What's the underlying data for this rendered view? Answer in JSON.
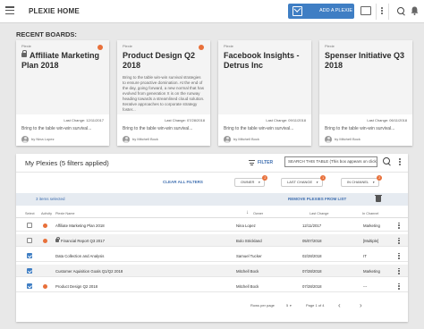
{
  "app": {
    "title": "PLEXIE HOME",
    "add_button": "ADD A PLEXIE"
  },
  "icons": [
    "menu-icon",
    "add-plexie-icon",
    "present-icon",
    "more-icon",
    "search-icon",
    "notifications-icon"
  ],
  "boards_section": {
    "title": "RECENT BOARDS:"
  },
  "boards": [
    {
      "type": "Plexie",
      "locked": true,
      "title": "Affiliate Marketing Plan 2018",
      "description": "",
      "last_change": "Last Change: 12/11/2017",
      "bring": "Bring to the table win-win survival...",
      "by": "by Nina Lopez",
      "active": true
    },
    {
      "type": "Plexie",
      "locked": false,
      "title": "Product Design Q2 2018",
      "description": "Bring to the table win-win survival strategies to ensure proactive domination. At the end of the day, going forward, a new normal that has evolved from generation X is on the runway heading towards a streamlined cloud solution. Iterative approaches to corporate strategy foster...",
      "last_change": "Last Change: 07/28/2018",
      "bring": "Bring to the table win-win survival...",
      "by": "by Mitchell Bock",
      "active": true
    },
    {
      "type": "Plexie",
      "locked": false,
      "title": "Facebook Insights - Detrus Inc",
      "description": "",
      "last_change": "Last Change: 09/11/2018",
      "bring": "Bring to the table win-win survival...",
      "by": "by Mitchell Bock",
      "active": false
    },
    {
      "type": "Plexie",
      "locked": false,
      "title": "Spenser Initiative Q3 2018",
      "description": "",
      "last_change": "Last Change: 06/11/2018",
      "bring": "Bring to the table win-win survival...",
      "by": "by Mitchell Bock",
      "active": false
    }
  ],
  "table": {
    "title": "My Plexies (5 filters applied)",
    "filter_label": "FILTER",
    "search_placeholder": "SEARCH THIS TABLE (This box appears on click)",
    "clear_all": "CLEAR ALL FILTERS",
    "filters": [
      {
        "label": "OWNER",
        "count": "2"
      },
      {
        "label": "LAST CHANGE",
        "count": "1"
      },
      {
        "label": "IN CHANNEL",
        "count": "2"
      }
    ],
    "selected_text": "3 items selected",
    "remove_label": "REMOVE PLEXIES FROM LIST",
    "columns": {
      "select": "Select",
      "activity": "Activity",
      "name": "Plexie Name",
      "owner": "Owner",
      "last_change": "Last Change",
      "channel": "In Channel"
    },
    "rows": [
      {
        "checked": false,
        "active": true,
        "locked": false,
        "name": "Affiliate Marketing Plan 2018",
        "owner": "Nina Lopez",
        "last_change": "12/11/2017",
        "channel": "Marketing"
      },
      {
        "checked": false,
        "active": true,
        "locked": true,
        "name": "Financial Report Q3  2017",
        "owner": "Bolo Strickland",
        "last_change": "05/07/2018",
        "channel": "[Multiple]"
      },
      {
        "checked": true,
        "active": false,
        "locked": false,
        "name": "Data Collection and Analysis",
        "owner": "Samuel Tucker",
        "last_change": "02/28/2018",
        "channel": "IT"
      },
      {
        "checked": true,
        "active": false,
        "locked": false,
        "name": "Customer Aquisition Goals Q1/Q2 2018",
        "owner": "Mitchell Bock",
        "last_change": "07/28/2018",
        "channel": "Marketing"
      },
      {
        "checked": true,
        "active": true,
        "locked": false,
        "name": "Product Design Q2 2018",
        "owner": "Mitchell Bock",
        "last_change": "07/28/2018",
        "channel": "---"
      }
    ],
    "pagination": {
      "rows_per_page_label": "Rows per page",
      "rows_per_page": "5",
      "page_info": "Page 1 of 4"
    }
  },
  "colors": {
    "accent": "#3f7ec4",
    "activity_dot": "#e8703a",
    "link": "#3f6fb0"
  }
}
